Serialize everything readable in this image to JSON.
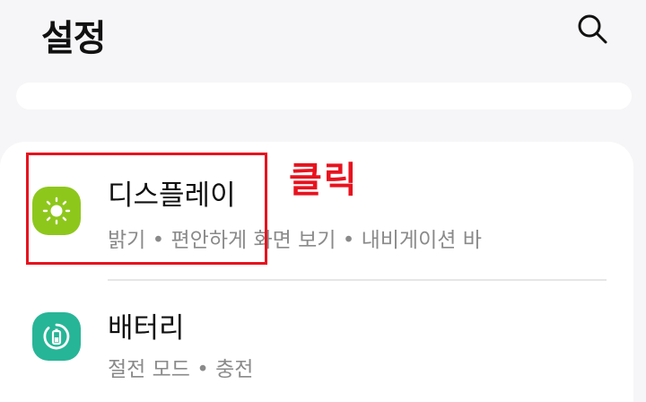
{
  "header": {
    "title": "설정",
    "search_icon": "search-icon"
  },
  "settings": {
    "items": [
      {
        "title": "디스플레이",
        "subtitle": "밝기  •  편안하게 화면 보기  •  내비게이션 바",
        "icon": "display-brightness-icon",
        "icon_color": "#8ec71c"
      },
      {
        "title": "배터리",
        "subtitle": "절전 모드  •  충전",
        "icon": "battery-icon",
        "icon_color": "#27b597"
      }
    ]
  },
  "annotation": {
    "label": "클릭",
    "color": "#e8121e"
  }
}
